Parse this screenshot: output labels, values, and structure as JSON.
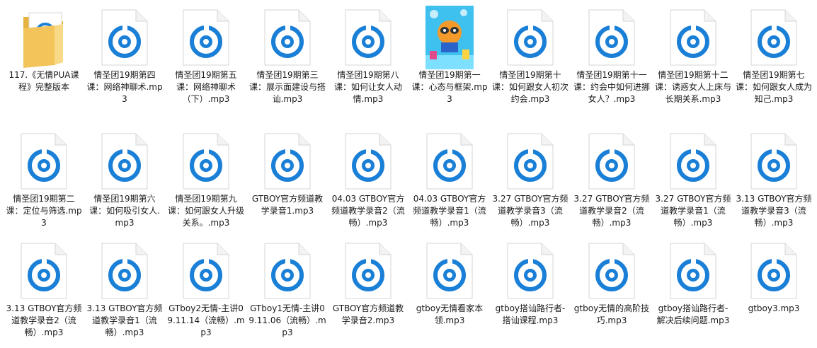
{
  "colors": {
    "accent": "#1a7fd6",
    "doc_bg": "#ffffff",
    "doc_border": "#d6d6d6",
    "folder": "#f2c45a"
  },
  "items": [
    {
      "label": "117.《无情PUA课程》完整版本",
      "icon": "folder-icon",
      "type": "folder"
    },
    {
      "label": "情圣团19期第四课：网络神聊术.mp3",
      "icon": "audio-file-icon",
      "type": "audio"
    },
    {
      "label": "情圣团19期第五课：网络神聊术（下）.mp3",
      "icon": "audio-file-icon",
      "type": "audio"
    },
    {
      "label": "情圣团19期第三课：展示面建设与搭讪.mp3",
      "icon": "audio-file-icon",
      "type": "audio"
    },
    {
      "label": "情圣团19期第八课：如何让女人动情.mp3",
      "icon": "audio-file-icon",
      "type": "audio"
    },
    {
      "label": "情圣团19期第一课：心态与框架.mp3",
      "icon": "cartoon-cover-icon",
      "type": "image"
    },
    {
      "label": "情圣团19期第十课：如何跟女人初次约会.mp3",
      "icon": "audio-file-icon",
      "type": "audio"
    },
    {
      "label": "情圣团19期第十一课：约会中如何进挪女人？.mp3",
      "icon": "audio-file-icon",
      "type": "audio"
    },
    {
      "label": "情圣团19期第十二课：诱惑女人上床与长期关系.mp3",
      "icon": "audio-file-icon",
      "type": "audio"
    },
    {
      "label": "情圣团19期第七课：如何跟女人成为知己.mp3",
      "icon": "audio-file-icon",
      "type": "audio"
    },
    {
      "label": "情圣团19期第二课：定位与筛选.mp3",
      "icon": "audio-file-icon",
      "type": "audio"
    },
    {
      "label": "情圣团19期第六课：如何吸引女人.mp3",
      "icon": "audio-file-icon",
      "type": "audio"
    },
    {
      "label": "情圣团19期第九课：如何跟女人升级关系。.mp3",
      "icon": "audio-file-icon",
      "type": "audio"
    },
    {
      "label": "GTBOY官方频道教学录音1.mp3",
      "icon": "audio-file-icon",
      "type": "audio"
    },
    {
      "label": "04.03 GTBOY官方频道教学录音2（流畅）.mp3",
      "icon": "audio-file-icon",
      "type": "audio"
    },
    {
      "label": "04.03 GTBOY官方频道教学录音1（流畅）.mp3",
      "icon": "audio-file-icon",
      "type": "audio"
    },
    {
      "label": "3.27 GTBOY官方频道教学录音3（流畅）.mp3",
      "icon": "audio-file-icon",
      "type": "audio"
    },
    {
      "label": "3.27 GTBOY官方频道教学录音2（流畅）.mp3",
      "icon": "audio-file-icon",
      "type": "audio"
    },
    {
      "label": "3.27 GTBOY官方频道教学录音1（流畅）.mp3",
      "icon": "audio-file-icon",
      "type": "audio"
    },
    {
      "label": "3.13 GTBOY官方频道教学录音3（流畅）.mp3",
      "icon": "audio-file-icon",
      "type": "audio"
    },
    {
      "label": "3.13 GTBOY官方频道教学录音2（流畅）.mp3",
      "icon": "audio-file-icon",
      "type": "audio"
    },
    {
      "label": "3.13 GTBOY官方频道教学录音1（流畅）.mp3",
      "icon": "audio-file-icon",
      "type": "audio"
    },
    {
      "label": "GTboy2无情-主讲09.11.14（流畅）.mp3",
      "icon": "audio-file-icon",
      "type": "audio"
    },
    {
      "label": "GTboy1无情-主讲09.11.06（流畅）.mp3",
      "icon": "audio-file-icon",
      "type": "audio"
    },
    {
      "label": "GTBOY官方频道教学录音2.mp3",
      "icon": "audio-file-icon",
      "type": "audio"
    },
    {
      "label": "gtboy无情看家本领.mp3",
      "icon": "audio-file-icon",
      "type": "audio"
    },
    {
      "label": "gtboy搭讪路行者-搭讪课程.mp3",
      "icon": "audio-file-icon",
      "type": "audio"
    },
    {
      "label": "gtboy无情的高阶技巧.mp3",
      "icon": "audio-file-icon",
      "type": "audio"
    },
    {
      "label": "gtboy搭讪路行者-解决后续问题.mp3",
      "icon": "audio-file-icon",
      "type": "audio"
    },
    {
      "label": "gtboy3.mp3",
      "icon": "audio-file-icon",
      "type": "audio"
    }
  ]
}
